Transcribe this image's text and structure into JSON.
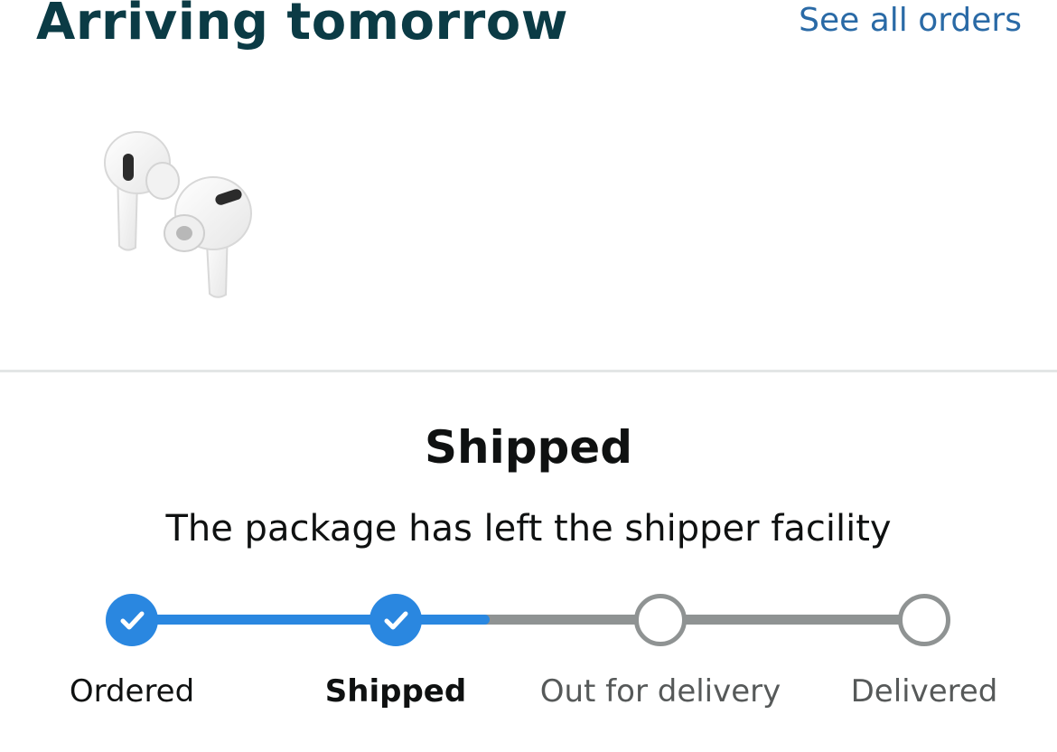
{
  "header": {
    "title": "Arriving tomorrow",
    "see_all_label": "See all orders"
  },
  "product": {
    "image_icon": "earbuds-image"
  },
  "status": {
    "title": "Shipped",
    "description": "The package has left the shipper facility"
  },
  "tracker": {
    "progress_fraction": 0.44,
    "steps": [
      {
        "label": "Ordered",
        "state": "done"
      },
      {
        "label": "Shipped",
        "state": "current"
      },
      {
        "label": "Out for delivery",
        "state": "pending"
      },
      {
        "label": "Delivered",
        "state": "pending"
      }
    ]
  },
  "colors": {
    "title": "#0b3b45",
    "link": "#2a6aa6",
    "progress": "#2a87e0",
    "pending": "#8f9393"
  }
}
